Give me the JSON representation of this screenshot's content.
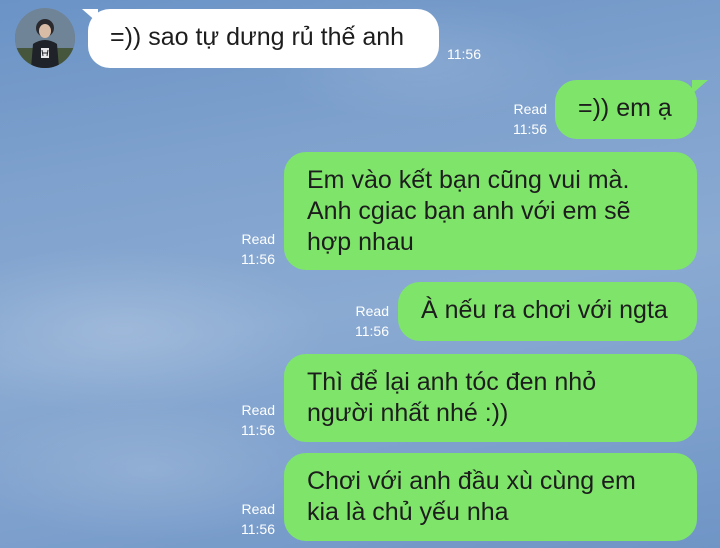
{
  "chat": {
    "incoming": [
      {
        "text": "=)) sao tự dưng rủ thế anh",
        "time": "11:56"
      }
    ],
    "outgoing": [
      {
        "text": "=)) em ạ",
        "status": "Read",
        "time": "11:56"
      },
      {
        "lines": [
          "Em vào kết bạn cũng vui mà.",
          "Anh cgiac bạn anh với em sẽ",
          "hợp nhau"
        ],
        "status": "Read",
        "time": "11:56"
      },
      {
        "text": "À nếu ra chơi với ngta",
        "status": "Read",
        "time": "11:56"
      },
      {
        "lines": [
          "Thì để lại anh tóc đen nhỏ",
          "người nhất nhé :))"
        ],
        "status": "Read",
        "time": "11:56"
      },
      {
        "lines": [
          "Chơi với anh đầu xù cùng em",
          "kia là chủ yếu nha"
        ],
        "status": "Read",
        "time": "11:56"
      }
    ]
  },
  "colors": {
    "outgoing_bubble": "#7ee56a",
    "incoming_bubble": "#ffffff",
    "background": "#7ea1cd"
  },
  "icons": {
    "avatar": "contact-avatar-photo"
  }
}
